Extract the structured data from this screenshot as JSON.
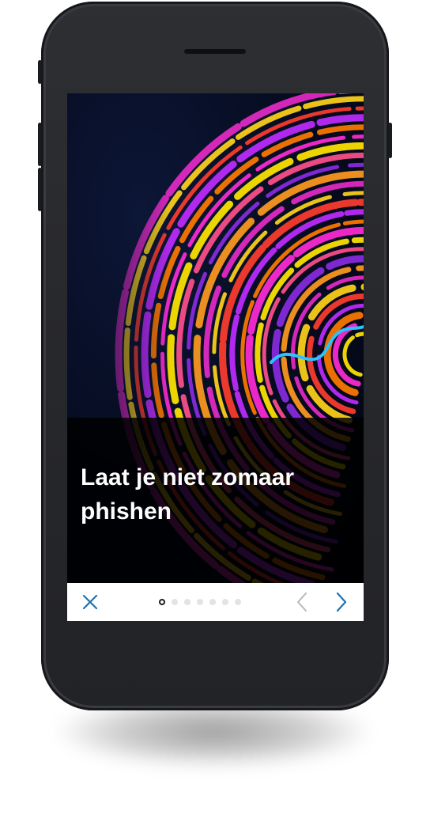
{
  "slide": {
    "headline_line1": "Laat je niet zomaar",
    "headline_line2": "phishen",
    "image": "fingerprint-rainbow-illustration"
  },
  "pager": {
    "total_pages": 7,
    "current_page": 1
  },
  "nav": {
    "close_icon": "close-icon",
    "prev_icon": "chevron-left-icon",
    "next_icon": "chevron-right-icon"
  },
  "colors": {
    "accent": "#1b74b5",
    "disabled": "#b9b9b9",
    "dot_inactive": "#e3e3e3",
    "headline_text": "#ffffff",
    "caption_overlay": "#000000"
  }
}
